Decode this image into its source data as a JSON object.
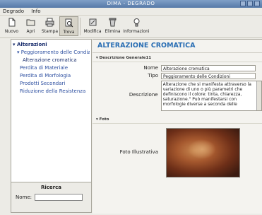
{
  "window": {
    "title": "DIMA - DEGRADO"
  },
  "menu": [
    "Degrado",
    "Info"
  ],
  "toolbar": [
    {
      "label": "Nuovo",
      "icon": "new-file-icon"
    },
    {
      "label": "Apri",
      "icon": "open-folder-icon"
    },
    {
      "label": "Stampa",
      "icon": "print-icon"
    },
    {
      "label": "Trova",
      "icon": "find-icon"
    },
    {
      "label": "Modifica",
      "icon": "edit-icon"
    },
    {
      "label": "Elimina",
      "icon": "delete-icon"
    },
    {
      "label": "Informazioni",
      "icon": "info-bulb-icon"
    }
  ],
  "tree": {
    "root": "Alterazioni",
    "group": "Peggioramento delle Condizioni",
    "group_item": "Alterazione cromatica",
    "items": [
      "Perdita di Materiale",
      "Perdita di Morfologia",
      "Prodotti Secondari",
      "Riduzione della Resistenza"
    ]
  },
  "search": {
    "title": "Ricerca",
    "label": "Nome:",
    "value": ""
  },
  "detail": {
    "heading": "ALTERAZIONE CROMATICA",
    "section_general": "▾ Descrizione Generale11",
    "name_label": "Nome",
    "name_value": "Alterazione cromatica",
    "type_label": "Tipo",
    "type_value": "Peggioramento delle Condizioni",
    "desc_label": "Descrizione",
    "desc_value": "Alterazione che si manifesta attraverso la variazione di uno o più parametri che definiscono il colore: tinta, chiarezza, saturazione.\" Può manifestarsi con morfologie diverse a seconda delle",
    "section_photo": "▾ Foto",
    "photo_label": "Foto Illustrativa"
  }
}
